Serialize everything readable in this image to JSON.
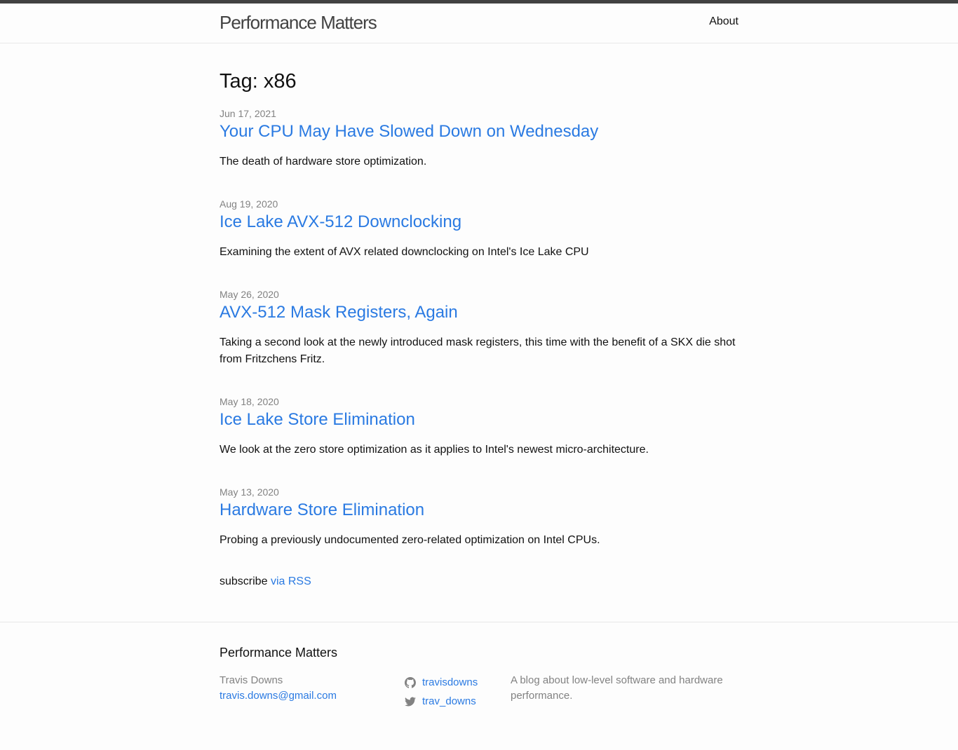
{
  "header": {
    "site_title": "Performance Matters",
    "nav": [
      {
        "label": "About"
      }
    ]
  },
  "page": {
    "heading": "Tag: x86",
    "posts": [
      {
        "date": "Jun 17, 2021",
        "title": "Your CPU May Have Slowed Down on Wednesday",
        "excerpt": "The death of hardware store optimization."
      },
      {
        "date": "Aug 19, 2020",
        "title": "Ice Lake AVX-512 Downclocking",
        "excerpt": "Examining the extent of AVX related downclocking on Intel's Ice Lake CPU"
      },
      {
        "date": "May 26, 2020",
        "title": "AVX-512 Mask Registers, Again",
        "excerpt": "Taking a second look at the newly introduced mask registers, this time with the benefit of a SKX die shot from Fritzchens Fritz."
      },
      {
        "date": "May 18, 2020",
        "title": "Ice Lake Store Elimination",
        "excerpt": "We look at the zero store optimization as it applies to Intel's newest micro-architecture."
      },
      {
        "date": "May 13, 2020",
        "title": "Hardware Store Elimination",
        "excerpt": "Probing a previously undocumented zero-related optimization on Intel CPUs."
      }
    ],
    "subscribe_prefix": "subscribe",
    "subscribe_link": "via RSS"
  },
  "footer": {
    "heading": "Performance Matters",
    "author_name": "Travis Downs",
    "author_email": "travis.downs@gmail.com",
    "github_username": "travisdowns",
    "twitter_username": "trav_downs",
    "description": "A blog about low-level software and hardware performance."
  },
  "colors": {
    "link": "#2a7ae2",
    "meta": "#828282",
    "header_border": "#424242"
  },
  "icons": [
    "github-icon",
    "twitter-icon"
  ]
}
